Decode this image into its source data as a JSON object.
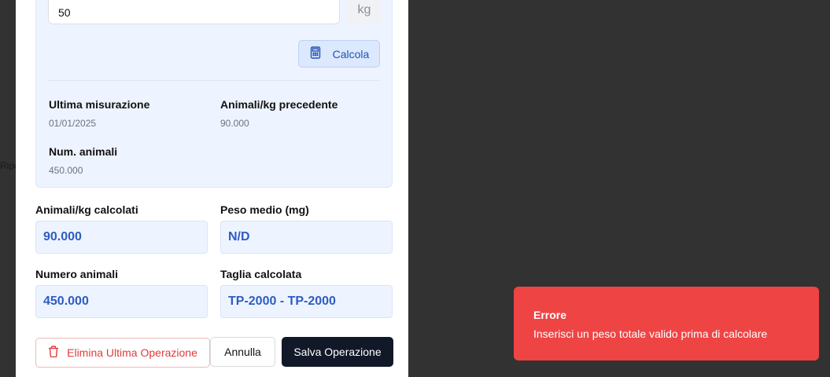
{
  "background": {
    "fragment_text": "Ripo"
  },
  "weight": {
    "value": "50",
    "unit": "kg"
  },
  "calc_button": {
    "label": "Calcola"
  },
  "info": {
    "last_measure_label": "Ultima misurazione",
    "last_measure_value": "01/01/2025",
    "prev_ratio_label": "Animali/kg precedente",
    "prev_ratio_value": "90.000",
    "num_animals_label": "Num. animali",
    "num_animals_value": "450.000"
  },
  "fields": {
    "calc_ratio_label": "Animali/kg calcolati",
    "calc_ratio_value": "90.000",
    "avg_weight_label": "Peso medio (mg)",
    "avg_weight_value": "N/D",
    "num_animals_label": "Numero animali",
    "num_animals_value": "450.000",
    "size_label": "Taglia calcolata",
    "size_value": "TP-2000 - TP-2000"
  },
  "actions": {
    "delete_label": "Elimina Ultima Operazione",
    "cancel_label": "Annulla",
    "save_label": "Salva Operazione"
  },
  "toast": {
    "title": "Errore",
    "message": "Inserisci un peso totale valido prima di calcolare"
  },
  "colors": {
    "overlay": "#323232",
    "accent_blue": "#2153b4",
    "danger": "#ef4444",
    "primary_dark": "#111827"
  },
  "icons": [
    "calculator-icon",
    "trash-icon"
  ]
}
